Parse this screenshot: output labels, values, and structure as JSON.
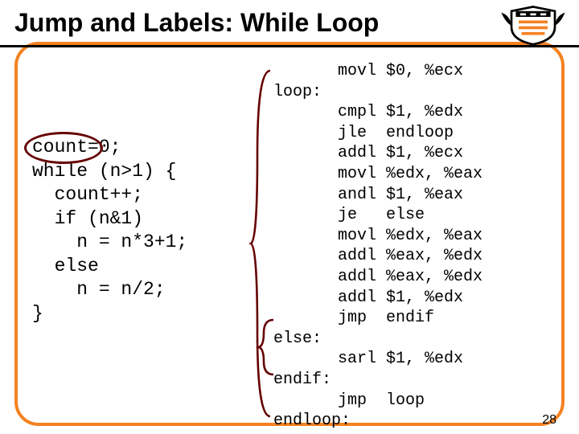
{
  "title": "Jump and Labels: While Loop",
  "pagenum": "28",
  "c": {
    "l1": "count=0;",
    "l2": "while (n>1) {",
    "l3": "  count++;",
    "l4": "  if (n&1)",
    "l5": "    n = n*3+1;",
    "l6": "  else",
    "l7": "    n = n/2;",
    "l8": "}"
  },
  "asm": [
    {
      "label": "",
      "op": "movl",
      "args": "$0, %ecx"
    },
    {
      "label": "loop:",
      "op": "",
      "args": ""
    },
    {
      "label": "",
      "op": "cmpl",
      "args": "$1, %edx"
    },
    {
      "label": "",
      "op": "jle",
      "args": "endloop"
    },
    {
      "label": "",
      "op": "addl",
      "args": "$1, %ecx"
    },
    {
      "label": "",
      "op": "movl",
      "args": "%edx, %eax"
    },
    {
      "label": "",
      "op": "andl",
      "args": "$1, %eax"
    },
    {
      "label": "",
      "op": "je",
      "args": "else"
    },
    {
      "label": "",
      "op": "movl",
      "args": "%edx, %eax"
    },
    {
      "label": "",
      "op": "addl",
      "args": "%eax, %edx"
    },
    {
      "label": "",
      "op": "addl",
      "args": "%eax, %edx"
    },
    {
      "label": "",
      "op": "addl",
      "args": "$1, %edx"
    },
    {
      "label": "",
      "op": "jmp",
      "args": "endif"
    },
    {
      "label": "else:",
      "op": "",
      "args": ""
    },
    {
      "label": "",
      "op": "sarl",
      "args": "$1, %edx"
    },
    {
      "label": "endif:",
      "op": "",
      "args": ""
    },
    {
      "label": "",
      "op": "jmp",
      "args": "loop"
    },
    {
      "label": "endloop:",
      "op": "",
      "args": ""
    }
  ]
}
